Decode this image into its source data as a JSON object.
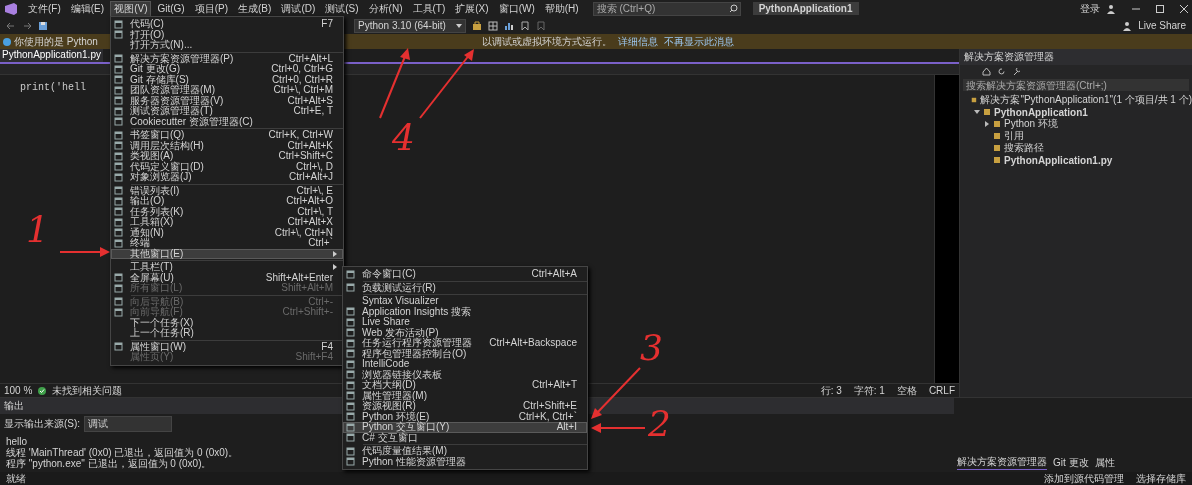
{
  "menubar": {
    "items": [
      {
        "label": "文件(F)",
        "selected": false
      },
      {
        "label": "编辑(E)",
        "selected": false
      },
      {
        "label": "视图(V)",
        "selected": true
      },
      {
        "label": "Git(G)",
        "selected": false
      },
      {
        "label": "项目(P)",
        "selected": false
      },
      {
        "label": "生成(B)",
        "selected": false
      },
      {
        "label": "调试(D)",
        "selected": false
      },
      {
        "label": "测试(S)",
        "selected": false
      },
      {
        "label": "分析(N)",
        "selected": false
      },
      {
        "label": "工具(T)",
        "selected": false
      },
      {
        "label": "扩展(X)",
        "selected": false
      },
      {
        "label": "窗口(W)",
        "selected": false
      },
      {
        "label": "帮助(H)",
        "selected": false
      }
    ]
  },
  "search": {
    "placeholder": "搜索 (Ctrl+Q)"
  },
  "solution_name": "PythonApplication1",
  "account": {
    "sign_in": "登录",
    "live_share": "Live Share"
  },
  "toolbar": {
    "interpreter": "Python 3.10 (64-bit)"
  },
  "infobar": {
    "message_start": "你使用的是 Python",
    "message_end": "以调试或虚拟环境方式运行。",
    "links": [
      "详细信息",
      "不再显示此消息"
    ]
  },
  "editor": {
    "tab": "PythonApplication1.py",
    "code": "print('hell",
    "zoom": "100 %",
    "issues": "未找到相关问题",
    "position": [
      "行: 3",
      "字符: 1",
      "空格",
      "CRLF"
    ]
  },
  "view_menu": [
    {
      "kind": "item",
      "label": "代码(C)",
      "shortcut": "F7",
      "icon": true,
      "selected": false,
      "disabled": false
    },
    {
      "kind": "item",
      "label": "打开(O)",
      "icon": true,
      "selected": false,
      "disabled": false
    },
    {
      "kind": "item",
      "label": "打开方式(N)...",
      "icon": false,
      "selected": false,
      "disabled": false
    },
    {
      "kind": "separator"
    },
    {
      "kind": "item",
      "label": "解决方案资源管理器(P)",
      "shortcut": "Ctrl+Alt+L",
      "icon": true,
      "selected": false,
      "disabled": false
    },
    {
      "kind": "item",
      "label": "Git 更改(G)",
      "shortcut": "Ctrl+0, Ctrl+G",
      "icon": true,
      "selected": false,
      "disabled": false
    },
    {
      "kind": "item",
      "label": "Git 存储库(S)",
      "shortcut": "Ctrl+0, Ctrl+R",
      "icon": true,
      "selected": false,
      "disabled": false
    },
    {
      "kind": "item",
      "label": "团队资源管理器(M)",
      "shortcut": "Ctrl+\\, Ctrl+M",
      "icon": true,
      "selected": false,
      "disabled": false
    },
    {
      "kind": "item",
      "label": "服务器资源管理器(V)",
      "shortcut": "Ctrl+Alt+S",
      "icon": true,
      "selected": false,
      "disabled": false
    },
    {
      "kind": "item",
      "label": "测试资源管理器(T)",
      "shortcut": "Ctrl+E, T",
      "icon": true,
      "selected": false,
      "disabled": false
    },
    {
      "kind": "item",
      "label": "Cookiecutter 资源管理器(C)",
      "icon": true,
      "selected": false,
      "disabled": false
    },
    {
      "kind": "separator"
    },
    {
      "kind": "item",
      "label": "书签窗口(Q)",
      "shortcut": "Ctrl+K, Ctrl+W",
      "icon": true,
      "selected": false,
      "disabled": false
    },
    {
      "kind": "item",
      "label": "调用层次结构(H)",
      "shortcut": "Ctrl+Alt+K",
      "icon": true,
      "selected": false,
      "disabled": false
    },
    {
      "kind": "item",
      "label": "类视图(A)",
      "shortcut": "Ctrl+Shift+C",
      "icon": true,
      "selected": false,
      "disabled": false
    },
    {
      "kind": "item",
      "label": "代码定义窗口(D)",
      "shortcut": "Ctrl+\\, D",
      "icon": true,
      "selected": false,
      "disabled": false
    },
    {
      "kind": "item",
      "label": "对象浏览器(J)",
      "shortcut": "Ctrl+Alt+J",
      "icon": true,
      "selected": false,
      "disabled": false
    },
    {
      "kind": "separator"
    },
    {
      "kind": "item",
      "label": "错误列表(I)",
      "shortcut": "Ctrl+\\, E",
      "icon": true,
      "selected": false,
      "disabled": false
    },
    {
      "kind": "item",
      "label": "输出(O)",
      "shortcut": "Ctrl+Alt+O",
      "icon": true,
      "selected": false,
      "disabled": false
    },
    {
      "kind": "item",
      "label": "任务列表(K)",
      "shortcut": "Ctrl+\\, T",
      "icon": true,
      "selected": false,
      "disabled": false
    },
    {
      "kind": "item",
      "label": "工具箱(X)",
      "shortcut": "Ctrl+Alt+X",
      "icon": true,
      "selected": false,
      "disabled": false
    },
    {
      "kind": "item",
      "label": "通知(N)",
      "shortcut": "Ctrl+\\, Ctrl+N",
      "icon": true,
      "selected": false,
      "disabled": false
    },
    {
      "kind": "item",
      "label": "终端",
      "shortcut": "Ctrl+`",
      "icon": true,
      "selected": false,
      "disabled": false
    },
    {
      "kind": "item",
      "label": "其他窗口(E)",
      "icon": false,
      "submenu": true,
      "selected": true,
      "disabled": false
    },
    {
      "kind": "separator"
    },
    {
      "kind": "item",
      "label": "工具栏(T)",
      "icon": false,
      "submenu": true,
      "selected": false,
      "disabled": false
    },
    {
      "kind": "item",
      "label": "全屏幕(U)",
      "shortcut": "Shift+Alt+Enter",
      "icon": true,
      "selected": false,
      "disabled": false
    },
    {
      "kind": "item",
      "label": "所有窗口(L)",
      "shortcut": "Shift+Alt+M",
      "icon": true,
      "selected": false,
      "disabled": true
    },
    {
      "kind": "separator"
    },
    {
      "kind": "item",
      "label": "向后导航(B)",
      "shortcut": "Ctrl+-",
      "icon": true,
      "selected": false,
      "disabled": true
    },
    {
      "kind": "item",
      "label": "向前导航(F)",
      "shortcut": "Ctrl+Shift+-",
      "icon": true,
      "selected": false,
      "disabled": true
    },
    {
      "kind": "item",
      "label": "下一个任务(X)",
      "icon": false,
      "selected": false,
      "disabled": false
    },
    {
      "kind": "item",
      "label": "上一个任务(R)",
      "icon": false,
      "selected": false,
      "disabled": false
    },
    {
      "kind": "separator"
    },
    {
      "kind": "item",
      "label": "属性窗口(W)",
      "shortcut": "F4",
      "icon": true,
      "selected": false,
      "disabled": false
    },
    {
      "kind": "item",
      "label": "属性页(Y)",
      "shortcut": "Shift+F4",
      "icon": false,
      "selected": false,
      "disabled": true
    }
  ],
  "other_windows_menu": [
    {
      "kind": "item",
      "label": "命令窗口(C)",
      "shortcut": "Ctrl+Alt+A",
      "icon": true,
      "selected": false
    },
    {
      "kind": "separator"
    },
    {
      "kind": "item",
      "label": "负载测试运行(R)",
      "icon": true,
      "selected": false
    },
    {
      "kind": "separator"
    },
    {
      "kind": "item",
      "label": "Syntax Visualizer",
      "icon": false,
      "selected": false
    },
    {
      "kind": "item",
      "label": "Application Insights 搜索",
      "icon": true,
      "selected": false
    },
    {
      "kind": "item",
      "label": "Live Share",
      "icon": true,
      "selected": false
    },
    {
      "kind": "item",
      "label": "Web 发布活动(P)",
      "icon": true,
      "selected": false
    },
    {
      "kind": "item",
      "label": "任务运行程序资源管理器",
      "shortcut": "Ctrl+Alt+Backspace",
      "icon": true,
      "selected": false
    },
    {
      "kind": "item",
      "label": "程序包管理器控制台(O)",
      "icon": true,
      "selected": false
    },
    {
      "kind": "item",
      "label": "IntelliCode",
      "icon": true,
      "selected": false
    },
    {
      "kind": "item",
      "label": "浏览器链接仪表板",
      "icon": true,
      "selected": false
    },
    {
      "kind": "item",
      "label": "文档大纲(D)",
      "shortcut": "Ctrl+Alt+T",
      "icon": true,
      "selected": false
    },
    {
      "kind": "item",
      "label": "属性管理器(M)",
      "icon": true,
      "selected": false
    },
    {
      "kind": "item",
      "label": "资源视图(R)",
      "shortcut": "Ctrl+Shift+E",
      "icon": true,
      "selected": false
    },
    {
      "kind": "item",
      "label": "Python 环境(E)",
      "shortcut": "Ctrl+K, Ctrl+`",
      "icon": true,
      "selected": false
    },
    {
      "kind": "item",
      "label": "Python 交互窗口(Y)",
      "shortcut": "Alt+I",
      "icon": true,
      "selected": true
    },
    {
      "kind": "item",
      "label": "C# 交互窗口",
      "icon": true,
      "selected": false
    },
    {
      "kind": "separator"
    },
    {
      "kind": "item",
      "label": "代码度量值结果(M)",
      "icon": true,
      "selected": false
    },
    {
      "kind": "item",
      "label": "Python 性能资源管理器",
      "icon": true,
      "selected": false
    }
  ],
  "solution_explorer": {
    "title": "解决方案资源管理器",
    "search": {
      "placeholder": "搜索解决方案资源管理器(Ctrl+;)"
    },
    "tree": [
      {
        "label": "解决方案\"PythonApplication1\"(1 个项目/共 1 个)",
        "children": [
          {
            "label": "PythonApplication1",
            "bold": true,
            "expanded": true,
            "children": [
              {
                "label": "Python 环境",
                "expanded": false
              },
              {
                "label": "引用"
              },
              {
                "label": "搜索路径"
              },
              {
                "label": "PythonApplication1.py",
                "bold": true
              }
            ]
          }
        ]
      }
    ],
    "tabs": [
      {
        "label": "解决方案资源管理器",
        "selected": true
      },
      {
        "label": "Git 更改",
        "selected": false
      },
      {
        "label": "属性",
        "selected": false
      }
    ]
  },
  "output": {
    "title": "输出",
    "source_label": "显示输出来源(S):",
    "source": "调试",
    "lines": [
      "hello",
      "线程 'MainThread' (0x0) 已退出，返回值为 0 (0x0)。",
      "程序 \"python.exe\" 已退出，返回值为 0 (0x0)。"
    ]
  },
  "status_bar": {
    "state": "就绪",
    "actions": [
      "添加到源代码管理",
      "选择存储库"
    ]
  },
  "annotations": [
    {
      "label": "1"
    },
    {
      "label": "2"
    },
    {
      "label": "3"
    },
    {
      "label": "4"
    }
  ]
}
